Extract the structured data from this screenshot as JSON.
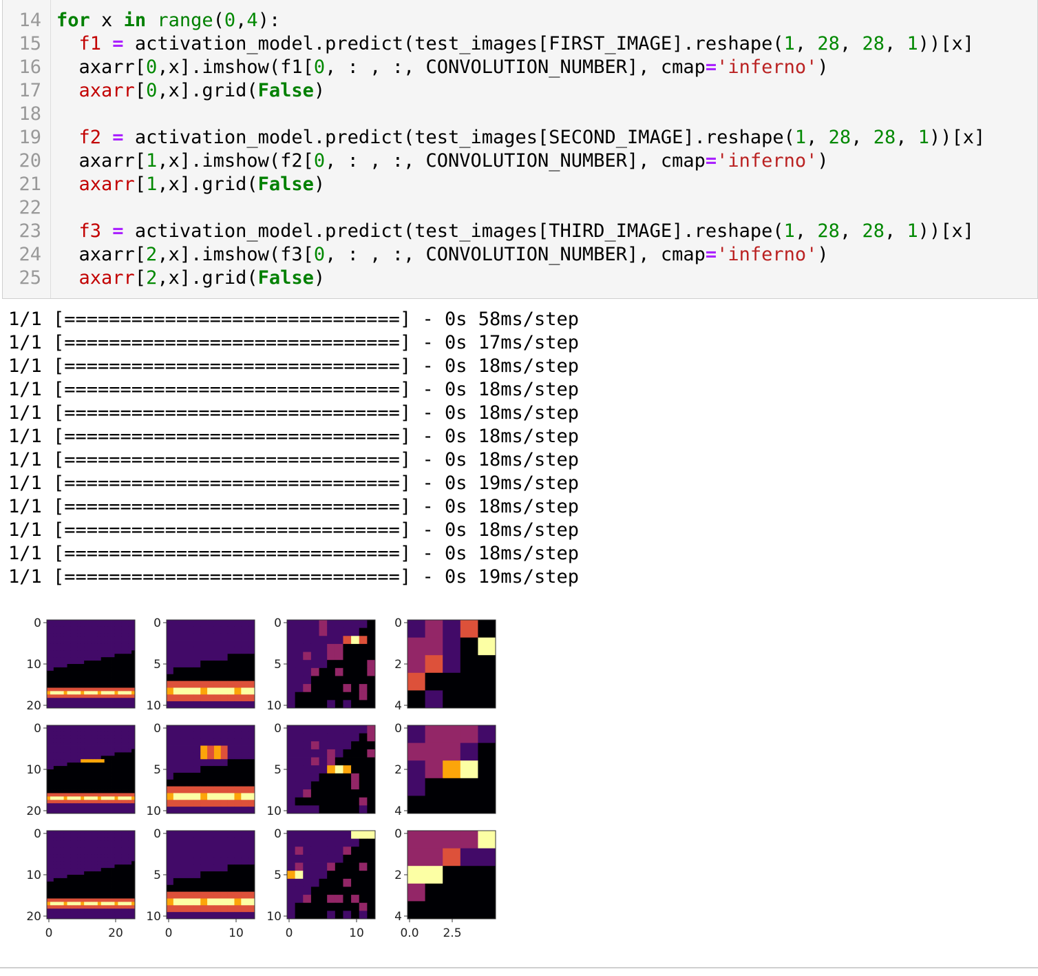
{
  "code": {
    "lines": [
      {
        "n": "14",
        "tokens": [
          {
            "t": "for",
            "c": "kw"
          },
          {
            "t": " x "
          },
          {
            "t": "in",
            "c": "kw"
          },
          {
            "t": " "
          },
          {
            "t": "range",
            "c": "bi"
          },
          {
            "t": "("
          },
          {
            "t": "0",
            "c": "num"
          },
          {
            "t": ","
          },
          {
            "t": "4",
            "c": "num"
          },
          {
            "t": "):"
          }
        ]
      },
      {
        "n": "15",
        "tokens": [
          {
            "t": "  "
          },
          {
            "t": "f1",
            "c": "var"
          },
          {
            "t": " "
          },
          {
            "t": "=",
            "c": "op"
          },
          {
            "t": " activation_model.predict(test_images[FIRST_IMAGE].reshape("
          },
          {
            "t": "1",
            "c": "num"
          },
          {
            "t": ", "
          },
          {
            "t": "28",
            "c": "num"
          },
          {
            "t": ", "
          },
          {
            "t": "28",
            "c": "num"
          },
          {
            "t": ", "
          },
          {
            "t": "1",
            "c": "num"
          },
          {
            "t": "))[x]"
          }
        ]
      },
      {
        "n": "16",
        "tokens": [
          {
            "t": "  axarr["
          },
          {
            "t": "0",
            "c": "num"
          },
          {
            "t": ",x].imshow(f1["
          },
          {
            "t": "0",
            "c": "num"
          },
          {
            "t": ", : , :, CONVOLUTION_NUMBER], cmap"
          },
          {
            "t": "=",
            "c": "op"
          },
          {
            "t": "'inferno'",
            "c": "str"
          },
          {
            "t": ")"
          }
        ]
      },
      {
        "n": "17",
        "tokens": [
          {
            "t": "  "
          },
          {
            "t": "axarr",
            "c": "var"
          },
          {
            "t": "["
          },
          {
            "t": "0",
            "c": "num"
          },
          {
            "t": ",x].grid("
          },
          {
            "t": "False",
            "c": "kw"
          },
          {
            "t": ")"
          }
        ]
      },
      {
        "n": "18",
        "tokens": []
      },
      {
        "n": "19",
        "tokens": [
          {
            "t": "  "
          },
          {
            "t": "f2",
            "c": "var"
          },
          {
            "t": " "
          },
          {
            "t": "=",
            "c": "op"
          },
          {
            "t": " activation_model.predict(test_images[SECOND_IMAGE].reshape("
          },
          {
            "t": "1",
            "c": "num"
          },
          {
            "t": ", "
          },
          {
            "t": "28",
            "c": "num"
          },
          {
            "t": ", "
          },
          {
            "t": "28",
            "c": "num"
          },
          {
            "t": ", "
          },
          {
            "t": "1",
            "c": "num"
          },
          {
            "t": "))[x]"
          }
        ]
      },
      {
        "n": "20",
        "tokens": [
          {
            "t": "  axarr["
          },
          {
            "t": "1",
            "c": "num"
          },
          {
            "t": ",x].imshow(f2["
          },
          {
            "t": "0",
            "c": "num"
          },
          {
            "t": ", : , :, CONVOLUTION_NUMBER], cmap"
          },
          {
            "t": "=",
            "c": "op"
          },
          {
            "t": "'inferno'",
            "c": "str"
          },
          {
            "t": ")"
          }
        ]
      },
      {
        "n": "21",
        "tokens": [
          {
            "t": "  "
          },
          {
            "t": "axarr",
            "c": "var"
          },
          {
            "t": "["
          },
          {
            "t": "1",
            "c": "num"
          },
          {
            "t": ",x].grid("
          },
          {
            "t": "False",
            "c": "kw"
          },
          {
            "t": ")"
          }
        ]
      },
      {
        "n": "22",
        "tokens": []
      },
      {
        "n": "23",
        "tokens": [
          {
            "t": "  "
          },
          {
            "t": "f3",
            "c": "var"
          },
          {
            "t": " "
          },
          {
            "t": "=",
            "c": "op"
          },
          {
            "t": " activation_model.predict(test_images[THIRD_IMAGE].reshape("
          },
          {
            "t": "1",
            "c": "num"
          },
          {
            "t": ", "
          },
          {
            "t": "28",
            "c": "num"
          },
          {
            "t": ", "
          },
          {
            "t": "28",
            "c": "num"
          },
          {
            "t": ", "
          },
          {
            "t": "1",
            "c": "num"
          },
          {
            "t": "))[x]"
          }
        ]
      },
      {
        "n": "24",
        "tokens": [
          {
            "t": "  axarr["
          },
          {
            "t": "2",
            "c": "num"
          },
          {
            "t": ",x].imshow(f3["
          },
          {
            "t": "0",
            "c": "num"
          },
          {
            "t": ", : , :, CONVOLUTION_NUMBER], cmap"
          },
          {
            "t": "=",
            "c": "op"
          },
          {
            "t": "'inferno'",
            "c": "str"
          },
          {
            "t": ")"
          }
        ]
      },
      {
        "n": "25",
        "tokens": [
          {
            "t": "  "
          },
          {
            "t": "axarr",
            "c": "var"
          },
          {
            "t": "["
          },
          {
            "t": "2",
            "c": "num"
          },
          {
            "t": ",x].grid("
          },
          {
            "t": "False",
            "c": "kw"
          },
          {
            "t": ")"
          }
        ]
      }
    ]
  },
  "output": {
    "lines": [
      "1/1 [==============================] - 0s 58ms/step",
      "1/1 [==============================] - 0s 17ms/step",
      "1/1 [==============================] - 0s 18ms/step",
      "1/1 [==============================] - 0s 18ms/step",
      "1/1 [==============================] - 0s 18ms/step",
      "1/1 [==============================] - 0s 18ms/step",
      "1/1 [==============================] - 0s 18ms/step",
      "1/1 [==============================] - 0s 19ms/step",
      "1/1 [==============================] - 0s 18ms/step",
      "1/1 [==============================] - 0s 18ms/step",
      "1/1 [==============================] - 0s 18ms/step",
      "1/1 [==============================] - 0s 19ms/step"
    ]
  },
  "plots": {
    "columns": [
      {
        "size": 26,
        "yticks": [
          "0",
          "10",
          "20"
        ],
        "xticks": [
          "0",
          "20"
        ]
      },
      {
        "size": 13,
        "yticks": [
          "0",
          "5",
          "10"
        ],
        "xticks": [
          "0",
          "10"
        ]
      },
      {
        "size": 11,
        "yticks": [
          "0",
          "5",
          "10"
        ],
        "xticks": [
          "0",
          "10"
        ]
      },
      {
        "size": 5,
        "yticks": [
          "0",
          "2",
          "4"
        ],
        "xticks": [
          "0.0",
          "2.5"
        ]
      }
    ],
    "row_count": 3,
    "colormap": "inferno",
    "colors": {
      "black": "#000004",
      "purple": "#420a68",
      "magenta": "#932667",
      "red": "#dd513a",
      "orange": "#fca50a",
      "yellow": "#fcffa4"
    }
  }
}
